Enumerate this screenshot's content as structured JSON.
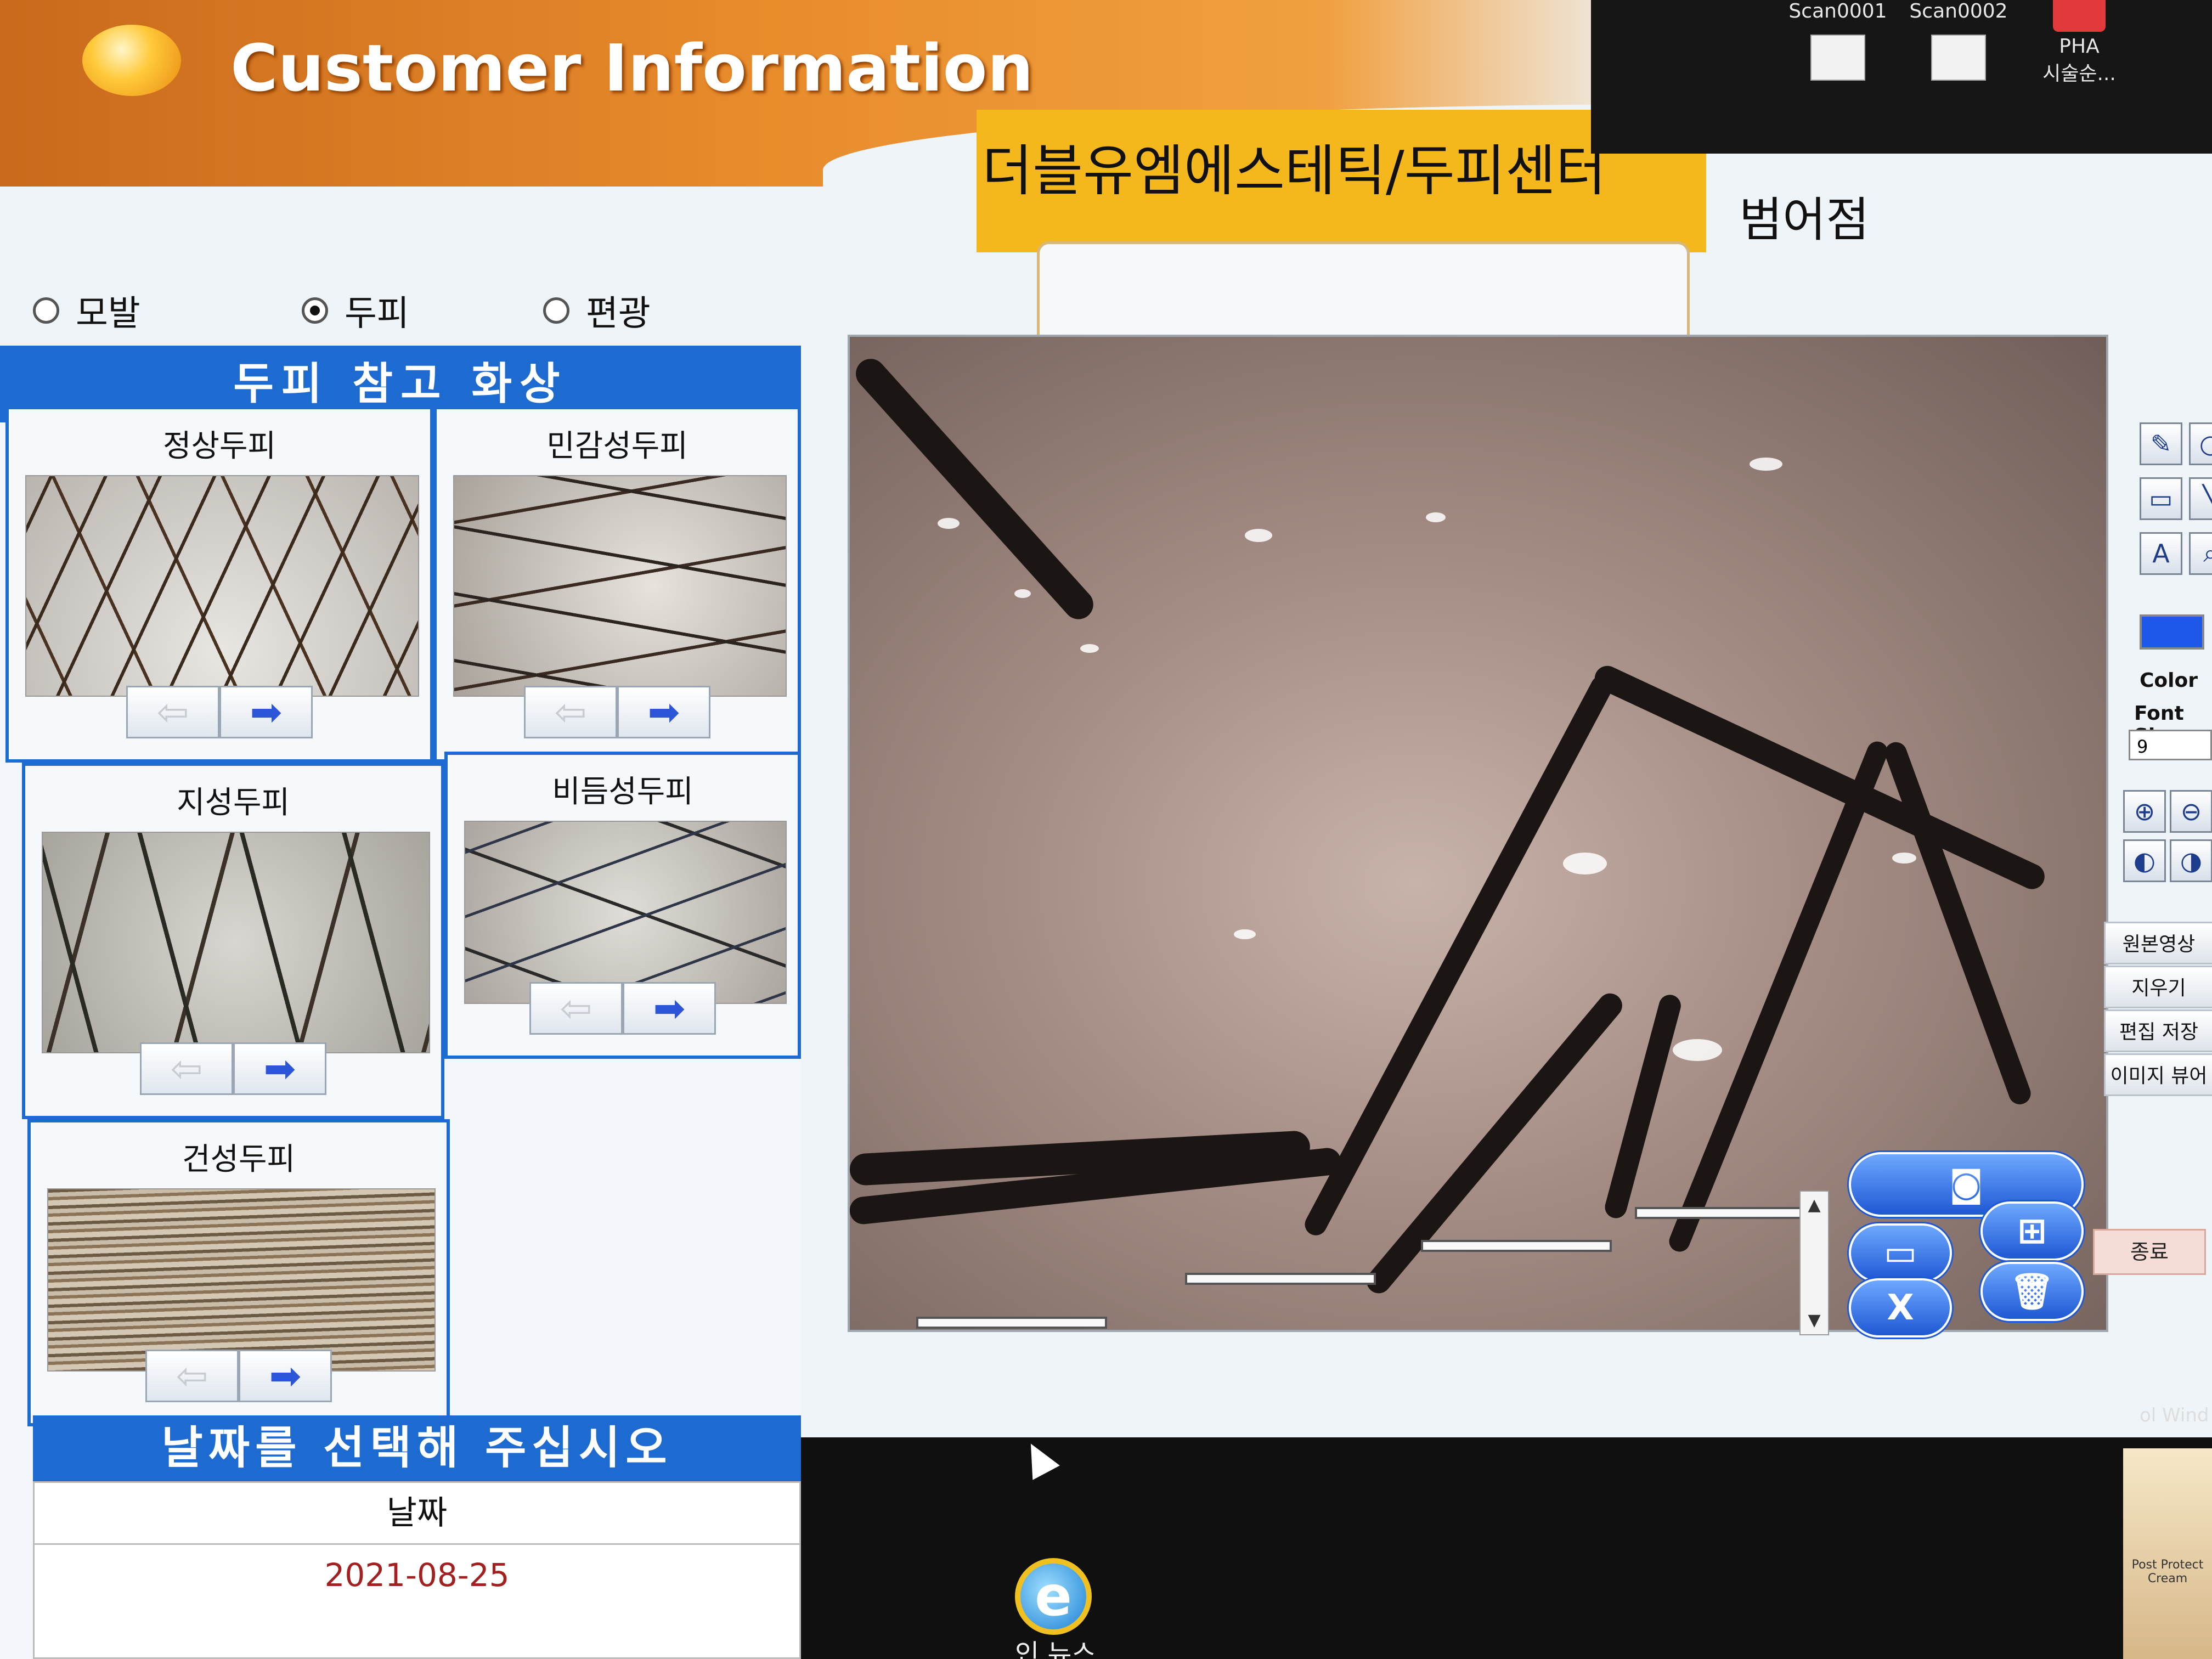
{
  "desktop": {
    "icons": [
      {
        "label": "Scan0001"
      },
      {
        "label": "Scan0002"
      },
      {
        "label": "PHA\n시술순..."
      }
    ]
  },
  "header": {
    "title": "Customer Information",
    "shop_name": "더블유엠에스테틱/두피센터",
    "branch": "범어점"
  },
  "mode_options": [
    {
      "label": "모발",
      "selected": false
    },
    {
      "label": "두피",
      "selected": true
    },
    {
      "label": "편광",
      "selected": false
    }
  ],
  "reference": {
    "title": "두피 참고 화상",
    "items": [
      {
        "label": "정상두피"
      },
      {
        "label": "민감성두피"
      },
      {
        "label": "지성두피"
      },
      {
        "label": "비듬성두피"
      },
      {
        "label": "건성두피"
      }
    ],
    "prev_icon": "arrow-left-icon",
    "next_icon": "arrow-right-icon"
  },
  "date_section": {
    "title": "날짜를 선택해 주십시오",
    "column_header": "날짜",
    "rows": [
      "2021-08-25"
    ]
  },
  "tools": {
    "color_label": "Color",
    "font_size_label": "Font Size",
    "font_size_value": "9",
    "color_value": "#1e58e8",
    "buttons": [
      "원본영상",
      "지우기",
      "편집 저장",
      "이미지 뷰어"
    ],
    "exit_label": "종료"
  },
  "capture": {
    "delete_label": "X"
  },
  "taskbar": {
    "ie_label": "인 뉴스",
    "windows_text": "ol Wind"
  },
  "product": {
    "label": "Post Protect Cream"
  }
}
